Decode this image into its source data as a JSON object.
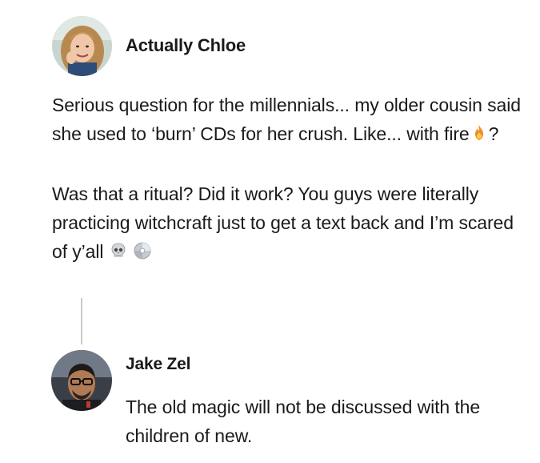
{
  "post": {
    "author": "Actually Chloe",
    "paragraph1": "Serious question for the millennials... my older cousin said she used to ‘burn’ CDs for her crush. Like... with fire",
    "paragraph1_emoji": "fire-emoji",
    "paragraph1_end": "?",
    "paragraph2": "Was that a ritual? Did it work? You guys were literally practicing witchcraft just to get a text back and I’m scared of y’all",
    "paragraph2_emojis": [
      "skull-emoji",
      "cd-emoji"
    ]
  },
  "reply": {
    "author": "Jake Zel",
    "text": "The old magic will not be discussed with the children of new."
  }
}
